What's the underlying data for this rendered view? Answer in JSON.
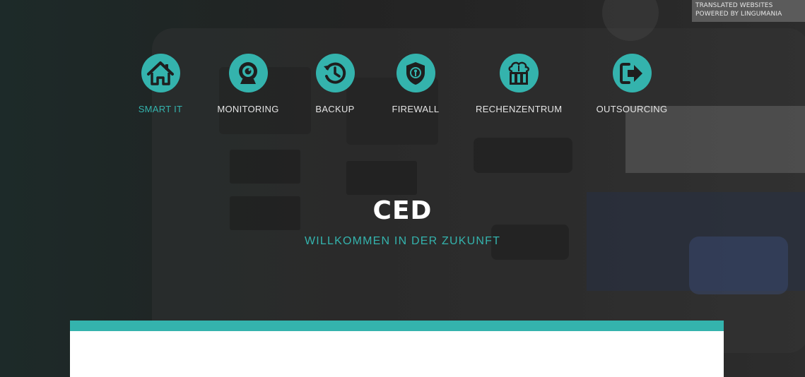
{
  "translation_badge": {
    "line1": "TRANSLATED WEBSITES",
    "line2": "POWERED BY LINGUMANIA"
  },
  "nav": {
    "items": [
      {
        "label": "SMART IT",
        "icon": "home-icon",
        "active": true
      },
      {
        "label": "MONITORING",
        "icon": "webcam-icon",
        "active": false
      },
      {
        "label": "BACKUP",
        "icon": "history-icon",
        "active": false
      },
      {
        "label": "FIREWALL",
        "icon": "shield-icon",
        "active": false
      },
      {
        "label": "RECHENZENTRUM",
        "icon": "cloud-server-icon",
        "active": false
      },
      {
        "label": "OUTSOURCING",
        "icon": "sign-out-icon",
        "active": false
      }
    ]
  },
  "hero": {
    "title": "CED",
    "subtitle": "WILLKOMMEN IN DER ZUKUNFT"
  },
  "colors": {
    "accent": "#34b3ad",
    "background": "#262626",
    "text_light": "#e4e4e4"
  }
}
